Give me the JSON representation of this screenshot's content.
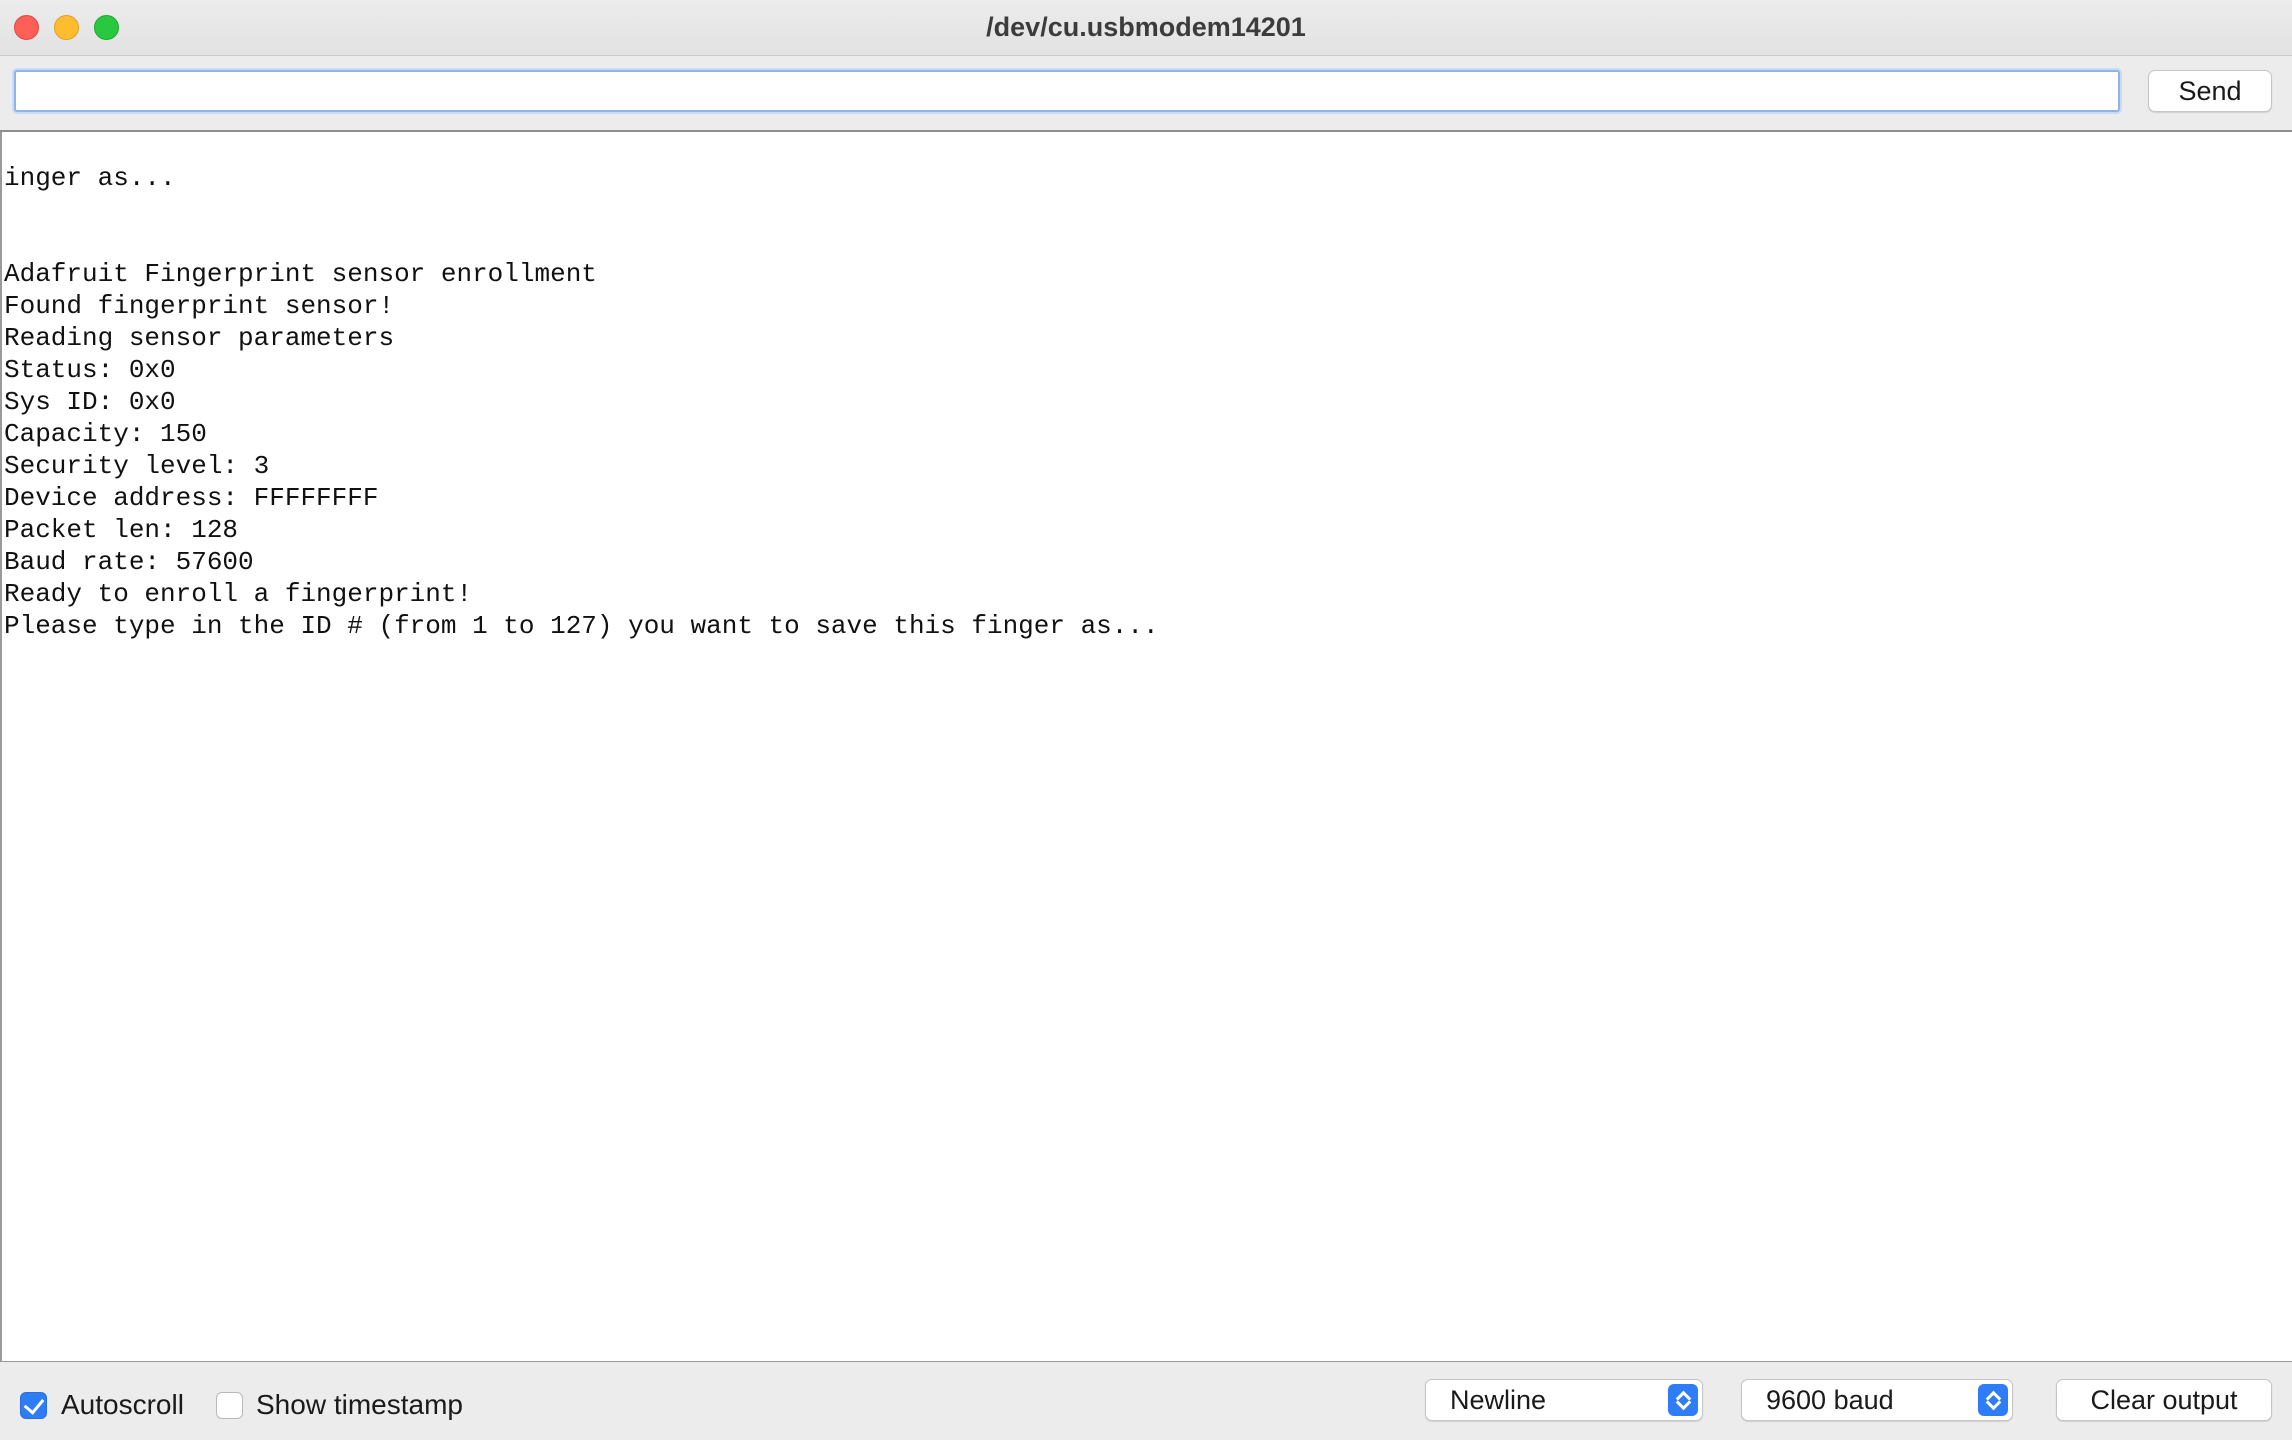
{
  "window": {
    "title": "/dev/cu.usbmodem14201"
  },
  "toolbar": {
    "input_value": "",
    "send_label": "Send"
  },
  "output": {
    "text": "inger as...\n\n\nAdafruit Fingerprint sensor enrollment\nFound fingerprint sensor!\nReading sensor parameters\nStatus: 0x0\nSys ID: 0x0\nCapacity: 150\nSecurity level: 3\nDevice address: FFFFFFFF\nPacket len: 128\nBaud rate: 57600\nReady to enroll a fingerprint!\nPlease type in the ID # (from 1 to 127) you want to save this finger as..."
  },
  "statusbar": {
    "autoscroll_label": "Autoscroll",
    "autoscroll_checked": true,
    "timestamp_label": "Show timestamp",
    "timestamp_checked": false,
    "line_ending": "Newline",
    "baud_rate": "9600 baud",
    "clear_label": "Clear output"
  },
  "colors": {
    "accent": "#2e7cf6",
    "close": "#fe5f57",
    "minimize": "#febc2e",
    "maximize": "#28c840"
  }
}
